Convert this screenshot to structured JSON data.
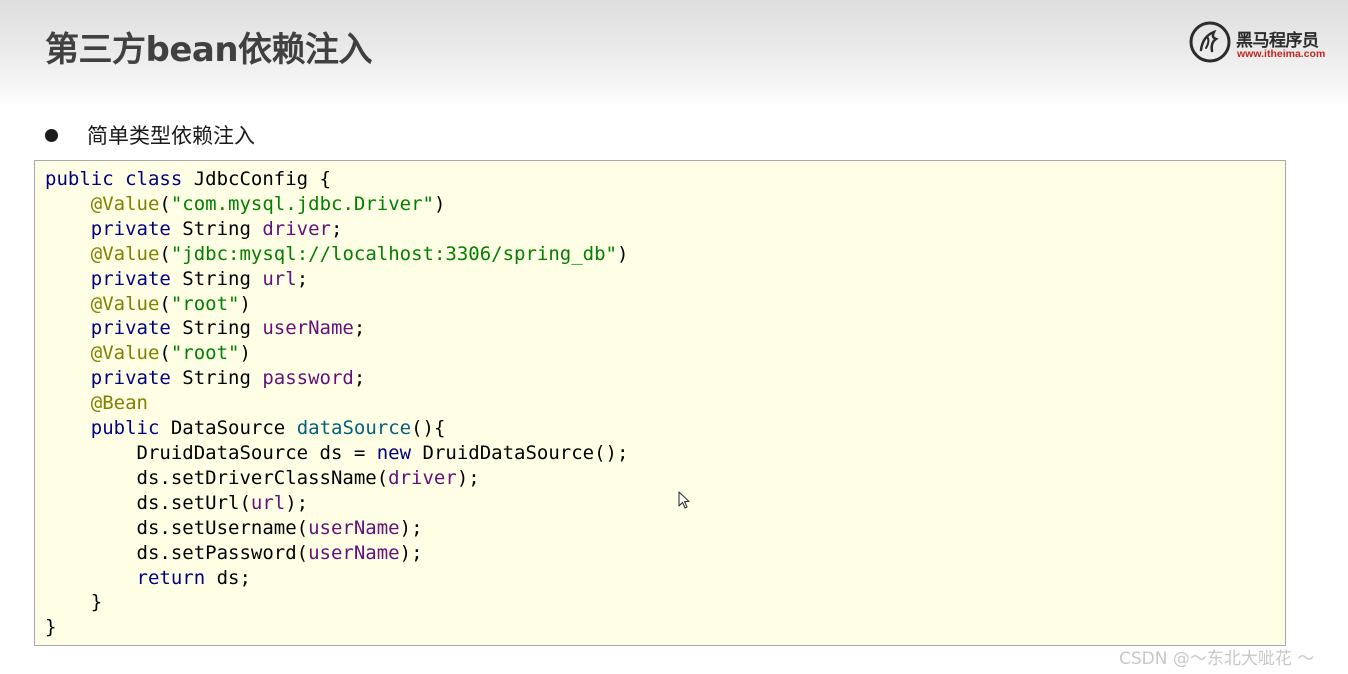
{
  "header": {
    "title": "第三方bean依赖注入",
    "logo": {
      "name": "黑马程序员",
      "url": "www.itheima.com"
    }
  },
  "bullet": {
    "text": "简单类型依赖注入"
  },
  "code": {
    "lines": [
      [
        {
          "t": "public ",
          "c": "kw"
        },
        {
          "t": "class ",
          "c": "kw"
        },
        {
          "t": "JdbcConfig {",
          "c": ""
        }
      ],
      [
        {
          "t": "    ",
          "c": ""
        },
        {
          "t": "@Value",
          "c": "ann"
        },
        {
          "t": "(",
          "c": ""
        },
        {
          "t": "\"com.mysql.jdbc.Driver\"",
          "c": "str"
        },
        {
          "t": ")",
          "c": ""
        }
      ],
      [
        {
          "t": "    ",
          "c": ""
        },
        {
          "t": "private ",
          "c": "kw"
        },
        {
          "t": "String ",
          "c": ""
        },
        {
          "t": "driver",
          "c": "fld"
        },
        {
          "t": ";",
          "c": ""
        }
      ],
      [
        {
          "t": "    ",
          "c": ""
        },
        {
          "t": "@Value",
          "c": "ann"
        },
        {
          "t": "(",
          "c": ""
        },
        {
          "t": "\"jdbc:mysql://localhost:3306/spring_db\"",
          "c": "str"
        },
        {
          "t": ")",
          "c": ""
        }
      ],
      [
        {
          "t": "    ",
          "c": ""
        },
        {
          "t": "private ",
          "c": "kw"
        },
        {
          "t": "String ",
          "c": ""
        },
        {
          "t": "url",
          "c": "fld"
        },
        {
          "t": ";",
          "c": ""
        }
      ],
      [
        {
          "t": "    ",
          "c": ""
        },
        {
          "t": "@Value",
          "c": "ann"
        },
        {
          "t": "(",
          "c": ""
        },
        {
          "t": "\"root\"",
          "c": "str"
        },
        {
          "t": ")",
          "c": ""
        }
      ],
      [
        {
          "t": "    ",
          "c": ""
        },
        {
          "t": "private ",
          "c": "kw"
        },
        {
          "t": "String ",
          "c": ""
        },
        {
          "t": "userName",
          "c": "fld"
        },
        {
          "t": ";",
          "c": ""
        }
      ],
      [
        {
          "t": "    ",
          "c": ""
        },
        {
          "t": "@Value",
          "c": "ann"
        },
        {
          "t": "(",
          "c": ""
        },
        {
          "t": "\"root\"",
          "c": "str"
        },
        {
          "t": ")",
          "c": ""
        }
      ],
      [
        {
          "t": "    ",
          "c": ""
        },
        {
          "t": "private ",
          "c": "kw"
        },
        {
          "t": "String ",
          "c": ""
        },
        {
          "t": "password",
          "c": "fld"
        },
        {
          "t": ";",
          "c": ""
        }
      ],
      [
        {
          "t": "    ",
          "c": ""
        },
        {
          "t": "@Bean",
          "c": "ann"
        }
      ],
      [
        {
          "t": "    ",
          "c": ""
        },
        {
          "t": "public ",
          "c": "kw"
        },
        {
          "t": "DataSource ",
          "c": ""
        },
        {
          "t": "dataSource",
          "c": "mtd"
        },
        {
          "t": "(){",
          "c": ""
        }
      ],
      [
        {
          "t": "        DruidDataSource ds = ",
          "c": ""
        },
        {
          "t": "new ",
          "c": "kw"
        },
        {
          "t": "DruidDataSource();",
          "c": ""
        }
      ],
      [
        {
          "t": "        ds.setDriverClassName(",
          "c": ""
        },
        {
          "t": "driver",
          "c": "fld"
        },
        {
          "t": ");",
          "c": ""
        }
      ],
      [
        {
          "t": "        ds.setUrl(",
          "c": ""
        },
        {
          "t": "url",
          "c": "fld"
        },
        {
          "t": ");",
          "c": ""
        }
      ],
      [
        {
          "t": "        ds.setUsername(",
          "c": ""
        },
        {
          "t": "userName",
          "c": "fld"
        },
        {
          "t": ");",
          "c": ""
        }
      ],
      [
        {
          "t": "        ds.setPassword(",
          "c": ""
        },
        {
          "t": "userName",
          "c": "fld"
        },
        {
          "t": ");",
          "c": ""
        }
      ],
      [
        {
          "t": "        ",
          "c": ""
        },
        {
          "t": "return ",
          "c": "kw"
        },
        {
          "t": "ds;",
          "c": ""
        }
      ],
      [
        {
          "t": "    }",
          "c": ""
        }
      ],
      [
        {
          "t": "}",
          "c": ""
        }
      ]
    ]
  },
  "watermark": "CSDN @～东北大呲花 ～"
}
